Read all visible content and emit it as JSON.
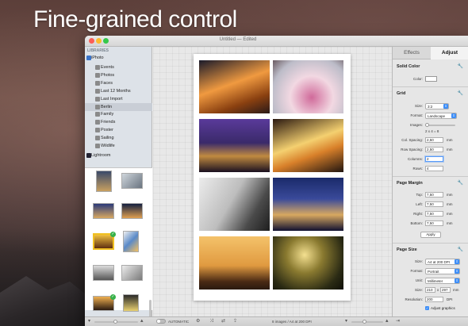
{
  "headline": "Fine-grained control",
  "window": {
    "title": "Untitled — Edited"
  },
  "sidebar": {
    "header": "LIBRARIES",
    "items": [
      {
        "label": "iPhoto",
        "icon": "iphoto-icon",
        "color": "#3a73c9"
      },
      {
        "label": "Events",
        "icon": "events-icon",
        "color": "#8a8a8a"
      },
      {
        "label": "Photos",
        "icon": "photos-icon",
        "color": "#8a8a8a"
      },
      {
        "label": "Faces",
        "icon": "faces-icon",
        "color": "#8a8a8a"
      },
      {
        "label": "Last 12 Months",
        "icon": "calendar-icon",
        "color": "#8a8a8a"
      },
      {
        "label": "Last Import",
        "icon": "import-icon",
        "color": "#8a8a8a"
      },
      {
        "label": "Berlin",
        "icon": "album-icon",
        "color": "#8a8a8a"
      },
      {
        "label": "Family",
        "icon": "album-icon",
        "color": "#8a8a8a"
      },
      {
        "label": "Friends",
        "icon": "album-icon",
        "color": "#8a8a8a"
      },
      {
        "label": "Poster",
        "icon": "album-icon",
        "color": "#8a8a8a"
      },
      {
        "label": "Sailing",
        "icon": "album-icon",
        "color": "#8a8a8a"
      },
      {
        "label": "Wildlife",
        "icon": "album-icon",
        "color": "#8a8a8a"
      },
      {
        "label": "Lightroom",
        "icon": "lightroom-icon",
        "color": "#223"
      }
    ],
    "selected": "Berlin"
  },
  "inspector": {
    "tabs": [
      "Effects",
      "Adjust"
    ],
    "active_tab": "Adjust",
    "solid_color": {
      "title": "Solid Color",
      "color_label": "Color:",
      "color_value": "#ffffff"
    },
    "grid": {
      "title": "Grid",
      "size_label": "Size:",
      "size_value": "3:2",
      "format_label": "Format:",
      "format_value": "Landscape",
      "images_label": "Images:",
      "images_info": "2 x 4 = 8",
      "col_spacing_label": "Col. Spacing:",
      "col_spacing_value": "2,50",
      "col_spacing_unit": "mm",
      "row_spacing_label": "Row Spacing:",
      "row_spacing_value": "2,50",
      "row_spacing_unit": "mm",
      "columns_label": "Columns:",
      "columns_value": "2",
      "rows_label": "Rows:",
      "rows_value": "4"
    },
    "page_margin": {
      "title": "Page Margin",
      "top_label": "Top:",
      "top_value": "7,50",
      "top_unit": "mm",
      "left_label": "Left:",
      "left_value": "7,50",
      "left_unit": "mm",
      "right_label": "Right:",
      "right_value": "7,50",
      "right_unit": "mm",
      "bottom_label": "Bottom:",
      "bottom_value": "7,50",
      "bottom_unit": "mm",
      "apply_label": "Apply"
    },
    "page_size": {
      "title": "Page Size",
      "size_label": "Size:",
      "size_value": "A4 at 200 DPI",
      "format_label": "Format:",
      "format_value": "Portrait",
      "unit_label": "Unit:",
      "unit_value": "Millimeter",
      "size2_label": "Size:",
      "width_value": "210",
      "x_sep": "x",
      "height_value": "297",
      "size2_unit": "mm",
      "resolution_label": "Resolution:",
      "resolution_value": "200",
      "resolution_unit": "DPI",
      "adjust_graphics_label": "Adjust graphics",
      "adjust_graphics_checked": true
    }
  },
  "bottombar": {
    "toggle_label": "AUTOMATIC",
    "status": "8 images / A4 at 200 DPI"
  },
  "photos": [
    {
      "name": "concert-hall",
      "colors": [
        "#f0a040",
        "#7a3a10",
        "#1a1020"
      ]
    },
    {
      "name": "sculpture-bolts",
      "colors": [
        "#f1d6e0",
        "#c06a8a",
        "#3a1520"
      ]
    },
    {
      "name": "oberbaum-bridge",
      "colors": [
        "#3a2a6a",
        "#c08a40",
        "#6a2a60"
      ]
    },
    {
      "name": "light-trails",
      "colors": [
        "#f4d070",
        "#d8802a",
        "#201510"
      ]
    },
    {
      "name": "marx-statue",
      "colors": [
        "#dcdcdc",
        "#8a8a8a",
        "#2a2a2a"
      ]
    },
    {
      "name": "berlin-cathedral",
      "colors": [
        "#2a3a7a",
        "#d8a860",
        "#101030"
      ]
    },
    {
      "name": "gasometer-sunset",
      "colors": [
        "#f0b050",
        "#a06020",
        "#2a1a10"
      ]
    },
    {
      "name": "street-lamps",
      "colors": [
        "#e8d070",
        "#4a4a20",
        "#101008"
      ]
    }
  ]
}
